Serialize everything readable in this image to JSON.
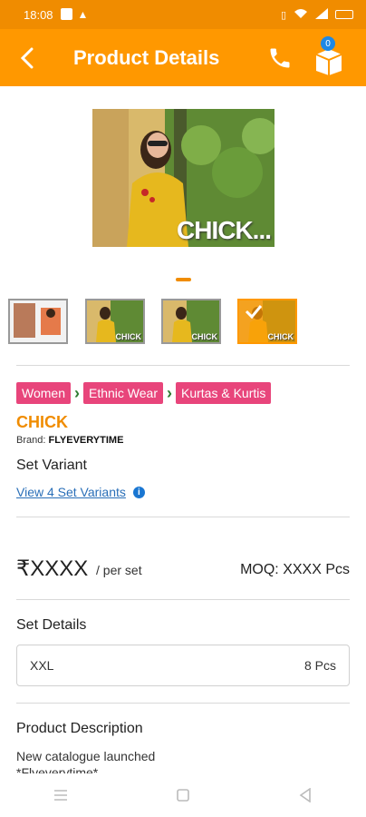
{
  "status_bar": {
    "time": "18:08"
  },
  "header": {
    "title": "Product Details",
    "cart_count": "0"
  },
  "gallery": {
    "main_watermark": "CHICK...",
    "thumbnails": [
      {
        "watermark": ""
      },
      {
        "watermark": "CHICK"
      },
      {
        "watermark": "CHICK"
      },
      {
        "watermark": "CHICK"
      }
    ],
    "selected_index": 3
  },
  "breadcrumb": [
    "Women",
    "Ethnic Wear",
    "Kurtas & Kurtis"
  ],
  "product": {
    "name": "CHICK",
    "brand_label": "Brand:",
    "brand_name": "FLYEVERYTIME"
  },
  "set_variant": {
    "label": "Set Variant",
    "link": "View 4 Set Variants"
  },
  "pricing": {
    "price": "₹XXXX",
    "unit": "/ per set",
    "moq": "MOQ: XXXX Pcs"
  },
  "set_details": {
    "label": "Set Details",
    "size": "XXL",
    "quantity": "8 Pcs"
  },
  "description": {
    "label": "Product Description",
    "text": "New catalogue launched\n*Flyeverytime*"
  },
  "colors": {
    "primary": "#ff9800",
    "status_bar": "#f08c00",
    "chip": "#e8457b",
    "link": "#2a6fb8"
  }
}
